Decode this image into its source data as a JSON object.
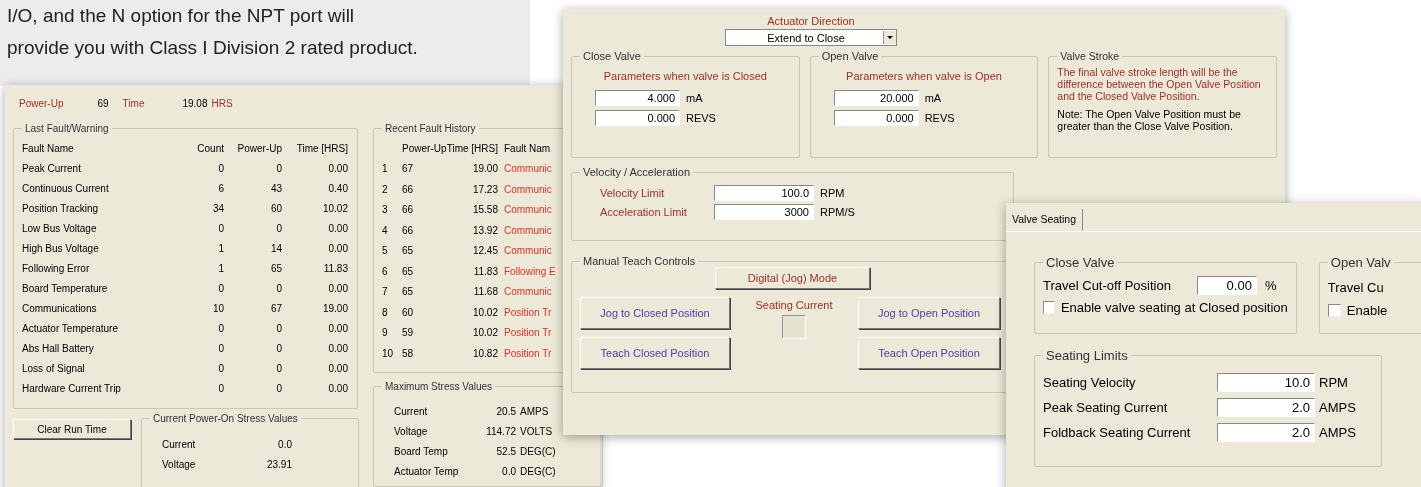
{
  "intro_text": [
    "I/O, and the N option for the NPT port will",
    "provide you with Class I Division 2 rated product."
  ],
  "fault_window": {
    "power_up_label": "Power-Up",
    "power_up": "69",
    "time_label": "Time",
    "time": "19.08",
    "time_unit": "HRS",
    "last_fault": {
      "title": "Last Fault/Warning",
      "columns": [
        "Fault Name",
        "Count",
        "Power-Up",
        "Time  [HRS]"
      ],
      "rows": [
        {
          "name": "Peak Current",
          "count": "0",
          "power_up": "0",
          "time": "0.00"
        },
        {
          "name": "Continuous Current",
          "count": "6",
          "power_up": "43",
          "time": "0.40"
        },
        {
          "name": "Position Tracking",
          "count": "34",
          "power_up": "60",
          "time": "10.02"
        },
        {
          "name": "Low Bus Voltage",
          "count": "0",
          "power_up": "0",
          "time": "0.00"
        },
        {
          "name": "High Bus Voltage",
          "count": "1",
          "power_up": "14",
          "time": "0.00"
        },
        {
          "name": "Following Error",
          "count": "1",
          "power_up": "65",
          "time": "11.83"
        },
        {
          "name": "Board Temperature",
          "count": "0",
          "power_up": "0",
          "time": "0.00"
        },
        {
          "name": "Communications",
          "count": "10",
          "power_up": "67",
          "time": "19.00"
        },
        {
          "name": "Actuator Temperature",
          "count": "0",
          "power_up": "0",
          "time": "0.00"
        },
        {
          "name": "Abs Hall Battery",
          "count": "0",
          "power_up": "0",
          "time": "0.00"
        },
        {
          "name": "Loss of Signal",
          "count": "0",
          "power_up": "0",
          "time": "0.00"
        },
        {
          "name": "Hardware Current Trip",
          "count": "0",
          "power_up": "0",
          "time": "0.00"
        }
      ]
    },
    "recent_history": {
      "title": "Recent Fault History",
      "columns": [
        "Power-Up",
        "Time [HRS]",
        "Fault Nam"
      ],
      "rows": [
        {
          "index": "1",
          "power_up": "67",
          "time": "19.00",
          "fault_name": "Communic"
        },
        {
          "index": "2",
          "power_up": "66",
          "time": "17.23",
          "fault_name": "Communic"
        },
        {
          "index": "3",
          "power_up": "66",
          "time": "15.58",
          "fault_name": "Communic"
        },
        {
          "index": "4",
          "power_up": "66",
          "time": "13.92",
          "fault_name": "Communic"
        },
        {
          "index": "5",
          "power_up": "65",
          "time": "12.45",
          "fault_name": "Communic"
        },
        {
          "index": "6",
          "power_up": "65",
          "time": "11.83",
          "fault_name": "Following E"
        },
        {
          "index": "7",
          "power_up": "65",
          "time": "11.68",
          "fault_name": "Communic"
        },
        {
          "index": "8",
          "power_up": "60",
          "time": "10.02",
          "fault_name": "Position Tr"
        },
        {
          "index": "9",
          "power_up": "59",
          "time": "10.02",
          "fault_name": "Position Tr"
        },
        {
          "index": "10",
          "power_up": "58",
          "time": "10.82",
          "fault_name": "Position Tr"
        }
      ]
    },
    "clear_button": "Clear Run Time",
    "current_stress": {
      "title": "Current Power-On Stress Values",
      "rows": [
        {
          "label": "Current",
          "value": "0.0"
        },
        {
          "label": "Voltage",
          "value": "23.91"
        }
      ]
    },
    "max_stress": {
      "title": "Maximum Stress Values",
      "rows": [
        {
          "label": "Current",
          "value": "20.5",
          "unit": "AMPS"
        },
        {
          "label": "Voltage",
          "value": "114.72",
          "unit": "VOLTS"
        },
        {
          "label": "Board Temp",
          "value": "52.5",
          "unit": "DEG(C)"
        },
        {
          "label": "Actuator Temp",
          "value": "0.0",
          "unit": "DEG(C)"
        }
      ]
    }
  },
  "actuator_window": {
    "direction_label": "Actuator Direction",
    "direction_value": "Extend to Close",
    "valves": [
      {
        "title": "Close Valve",
        "subtitle": "Parameters when valve is Closed",
        "fields": [
          {
            "value": "4.000",
            "unit": "mA"
          },
          {
            "value": "0.000",
            "unit": "REVS"
          }
        ]
      },
      {
        "title": "Open Valve",
        "subtitle": "Parameters when valve is Open",
        "fields": [
          {
            "value": "20.000",
            "unit": "mA"
          },
          {
            "value": "0.000",
            "unit": "REVS"
          }
        ]
      }
    ],
    "valve_stroke": {
      "title": "Valve Stroke",
      "text": "The final valve stroke length will be the difference between the Open Valve Position and the Closed Valve Position.",
      "note": "Note: The Open Valve Position must be greater than the Close Valve Position."
    },
    "velocity": {
      "title": "Velocity / Acceleration",
      "rows": [
        {
          "label": "Velocity Limit",
          "value": "100.0",
          "unit": "RPM"
        },
        {
          "label": "Acceleration Limit",
          "value": "3000",
          "unit": "RPM/S"
        }
      ]
    },
    "manual_teach": {
      "title": "Manual Teach Controls",
      "mode_button": "Digital (Jog) Mode",
      "seating_current_label": "Seating Current",
      "buttons": [
        "Jog to Closed Position",
        "Jog to Open Position",
        "Teach Closed Position",
        "Teach Open Position"
      ]
    }
  },
  "seating_window": {
    "tab": {
      "label": "Valve Seating",
      "selected": true
    },
    "close_valve": {
      "title": "Close Valve",
      "field_label": "Travel Cut-off Position",
      "value": "0.00",
      "unit": "%",
      "checkbox": {
        "label": "Enable valve seating at Closed position",
        "checked": false
      }
    },
    "open_valve": {
      "title": "Open Valv",
      "field_label": "Travel Cu",
      "checkbox": {
        "label": "Enable",
        "checked": false
      }
    },
    "seating_limits": {
      "title": "Seating Limits",
      "rows": [
        {
          "label": "Seating Velocity",
          "value": "10.0",
          "unit": "RPM"
        },
        {
          "label": "Peak Seating Current",
          "value": "2.0",
          "unit": "AMPS"
        },
        {
          "label": "Foldback Seating Current",
          "value": "2.0",
          "unit": "AMPS"
        }
      ]
    }
  }
}
